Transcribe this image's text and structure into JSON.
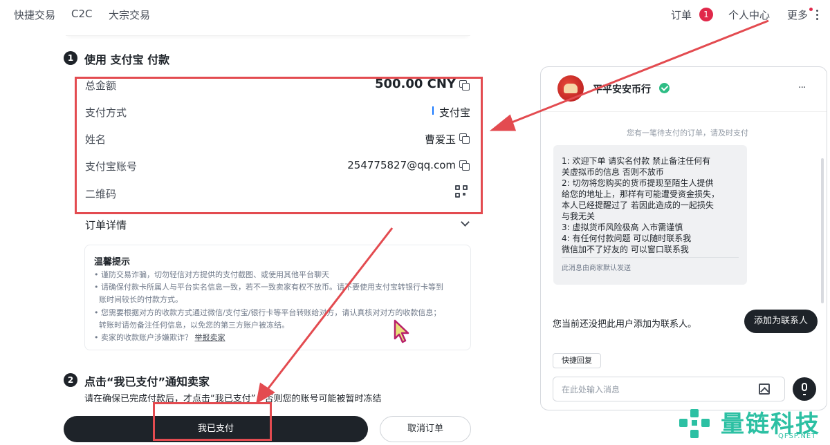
{
  "nav": {
    "left": [
      "快捷交易",
      "C2C",
      "大宗交易"
    ],
    "orders_label": "订单",
    "orders_count": "1",
    "profile_label": "个人中心",
    "more_label": "更多"
  },
  "step1": {
    "number": "1",
    "title": "使用 支付宝 付款",
    "rows": [
      {
        "label": "总金额",
        "value": "500.00 CNY"
      },
      {
        "label": "支付方式",
        "value": "支付宝"
      },
      {
        "label": "姓名",
        "value": "曹爱玉"
      },
      {
        "label": "支付宝账号",
        "value": "254775827@qq.com"
      },
      {
        "label": "二维码",
        "value": ""
      }
    ],
    "order_details_label": "订单详情"
  },
  "tips": {
    "title": "温馨提示",
    "lines": [
      "• 谨防交易诈骗，切勿轻信对方提供的支付截图、或使用其他平台聊天",
      "• 请确保付款卡所属人与平台实名信息一致，若不一致卖家有权不放币。请不要使用支付宝转银行卡等到",
      "  账时间较长的付款方式。",
      "• 您需要根据对方的收款方式通过微信/支付宝/银行卡等平台转账给对方，请认真核对对方的收款信息；",
      "  转账时请勿备注任何信息，以免您的第三方账户被冻结。",
      "• 卖家的收款账户涉嫌欺诈？"
    ],
    "report_link": "举报卖家"
  },
  "step2": {
    "number": "2",
    "title": "点击“我已支付”通知卖家",
    "notice": "请在确保已完成付款后，才点击“我已支付”，否则您的账号可能被暂时冻结"
  },
  "buttons": {
    "paid": "我已支付",
    "cancel": "取消订单"
  },
  "chat": {
    "merchant_name": "平平安安币行",
    "more": "···",
    "system_message": "您有一笔待支付的订单，请及时支付",
    "message_lines": [
      "1: 欢迎下单 请实名付款  禁止备注任何有",
      "关虚拟币的信息 否则不放币",
      "2: 切勿将您购买的货币提现至陌生人提供",
      "给您的地址上，那样有可能遭受资金损失，",
      "本人已经提醒过了 若因此造成的一起损失",
      "与我无关",
      "3: 虚拟货币风险极高 入市需谨慎",
      "4: 有任何付款问题  可以随时联系我",
      " 微信加不了好友的 可以窗口联系我"
    ],
    "message_footer": "此消息由商家默认发送",
    "add_contact_text": "您当前还没把此用户添加为联系人。",
    "add_contact_button": "添加为联系人",
    "quick_reply": "快捷回复",
    "input_placeholder": "在此处输入消息"
  },
  "watermark": {
    "text": "量链科技",
    "sub": "QFSP.NET"
  },
  "colors": {
    "annotation_red": "#e34b50",
    "badge_red": "#e0284a",
    "primary_dark": "#1e2329",
    "watermark_teal": "#2cc0a3"
  }
}
